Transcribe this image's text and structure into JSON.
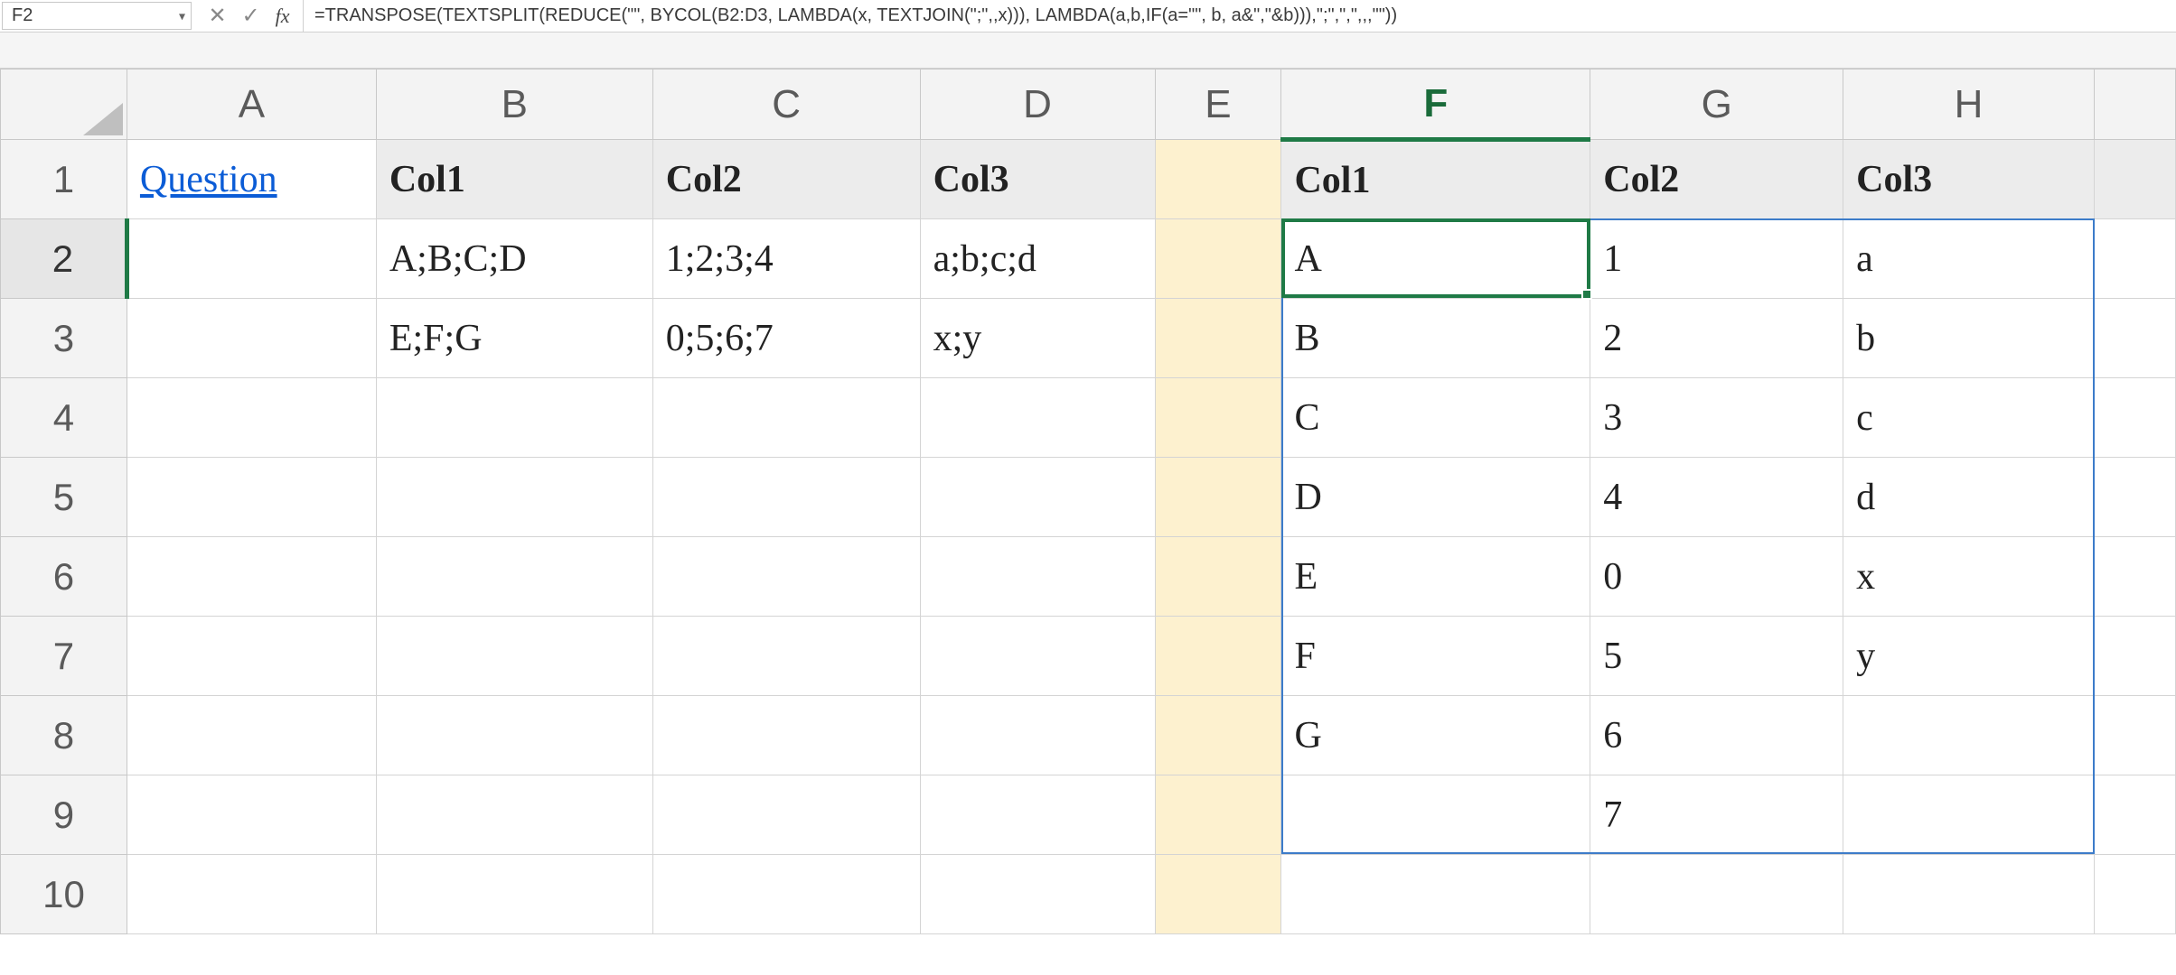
{
  "name_box": "F2",
  "formula": "=TRANSPOSE(TEXTSPLIT(REDUCE(\"\", BYCOL(B2:D3, LAMBDA(x, TEXTJOIN(\";\",,x))), LAMBDA(a,b,IF(a=\"\", b, a&\",\"&b))),\";\",\",\",,,\"\"))",
  "col_headers": [
    "A",
    "B",
    "C",
    "D",
    "E",
    "F",
    "G",
    "H",
    ""
  ],
  "row_headers": [
    "1",
    "2",
    "3",
    "4",
    "5",
    "6",
    "7",
    "8",
    "9",
    "10"
  ],
  "active_col": "F",
  "active_row": "2",
  "cells": {
    "A1": "Question",
    "B1": "Col1",
    "C1": "Col2",
    "D1": "Col3",
    "F1": "Col1",
    "G1": "Col2",
    "H1": "Col3",
    "B2": "A;B;C;D",
    "C2": "1;2;3;4",
    "D2": "a;b;c;d",
    "B3": "E;F;G",
    "C3": "0;5;6;7",
    "D3": "x;y",
    "F2": "A",
    "G2": "1",
    "H2": "a",
    "F3": "B",
    "G3": "2",
    "H3": "b",
    "F4": "C",
    "G4": "3",
    "H4": "c",
    "F5": "D",
    "G5": "4",
    "H5": "d",
    "F6": "E",
    "G6": "0",
    "H6": "x",
    "F7": "F",
    "G7": "5",
    "H7": "y",
    "F8": "G",
    "G8": "6",
    "G9": "7"
  },
  "spill_range": "F2:H9"
}
